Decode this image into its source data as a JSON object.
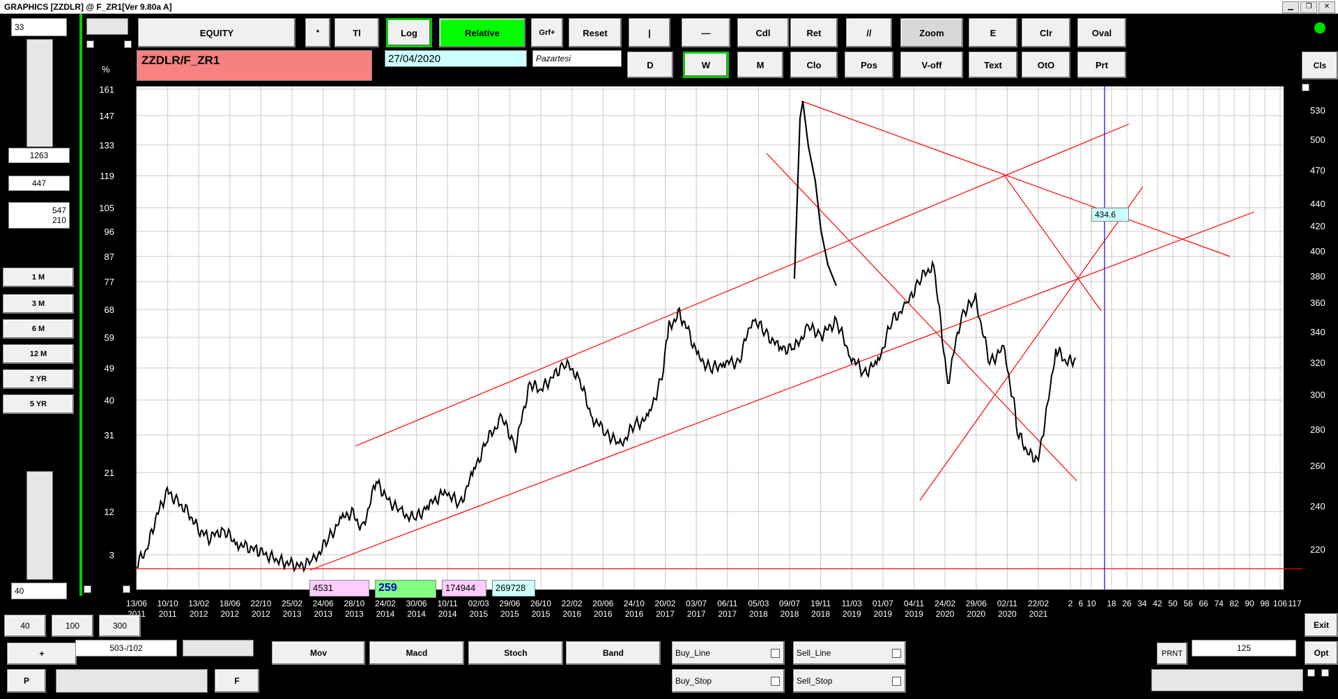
{
  "window": {
    "title": "GRAPHICS  [ZZDLR] @ F_ZR1[Ver 9.80a A]"
  },
  "left_panel": {
    "top_value": "33",
    "v1": "1263",
    "v2": "447",
    "v3a": "547",
    "v3b": "210",
    "period_buttons": [
      "1 M",
      "3 M",
      "6 M",
      "12 M",
      "2 YR",
      "5 YR"
    ],
    "bottom_value": "40"
  },
  "toolbar": {
    "row1": [
      "EQUITY",
      "*",
      "Tl",
      "Log",
      "Relative",
      "Grf+",
      "Reset",
      "|",
      "—",
      "Cdl",
      "Ret",
      "//",
      "Zoom",
      "E",
      "Clr",
      "Oval"
    ],
    "row2": [
      "D",
      "W",
      "M",
      "Clo",
      "Pos",
      "V-off",
      "Text",
      "OtO",
      "Prt"
    ],
    "cls": "Cls"
  },
  "info": {
    "symbol": "ZZDLR/F_ZR1",
    "date": "27/04/2020",
    "day": "Pazartesi",
    "percent_label": "%"
  },
  "y_left_ticks": [
    "161",
    "147",
    "133",
    "119",
    "105",
    "96",
    "87",
    "77",
    "68",
    "59",
    "49",
    "40",
    "31",
    "21",
    "12",
    "3"
  ],
  "y_right_ticks": [
    "530",
    "500",
    "470",
    "440",
    "420",
    "400",
    "380",
    "360",
    "340",
    "320",
    "300",
    "280",
    "260",
    "240",
    "220"
  ],
  "x_ticks": [
    {
      "d": "13/06",
      "y": "2011"
    },
    {
      "d": "10/10",
      "y": "2011"
    },
    {
      "d": "13/02",
      "y": "2012"
    },
    {
      "d": "18/06",
      "y": "2012"
    },
    {
      "d": "22/10",
      "y": "2012"
    },
    {
      "d": "25/02",
      "y": "2013"
    },
    {
      "d": "24/06",
      "y": "2013"
    },
    {
      "d": "28/10",
      "y": "2013"
    },
    {
      "d": "24/02",
      "y": "2014"
    },
    {
      "d": "30/06",
      "y": "2014"
    },
    {
      "d": "10/11",
      "y": "2014"
    },
    {
      "d": "02/03",
      "y": "2015"
    },
    {
      "d": "29/06",
      "y": "2015"
    },
    {
      "d": "26/10",
      "y": "2015"
    },
    {
      "d": "22/02",
      "y": "2016"
    },
    {
      "d": "20/06",
      "y": "2016"
    },
    {
      "d": "24/10",
      "y": "2016"
    },
    {
      "d": "20/02",
      "y": "2017"
    },
    {
      "d": "03/07",
      "y": "2017"
    },
    {
      "d": "06/11",
      "y": "2017"
    },
    {
      "d": "05/03",
      "y": "2018"
    },
    {
      "d": "09/07",
      "y": "2018"
    },
    {
      "d": "19/11",
      "y": "2018"
    },
    {
      "d": "11/03",
      "y": "2019"
    },
    {
      "d": "01/07",
      "y": "2019"
    },
    {
      "d": "04/11",
      "y": "2019"
    },
    {
      "d": "24/02",
      "y": "2020"
    },
    {
      "d": "29/06",
      "y": "2020"
    },
    {
      "d": "02/11",
      "y": "2020"
    },
    {
      "d": "22/02",
      "y": "2021"
    }
  ],
  "x_future_ticks": [
    "2",
    "6",
    "10",
    "18",
    "26",
    "34",
    "42",
    "50",
    "56",
    "66",
    "74",
    "82",
    "90",
    "98",
    "106",
    "117"
  ],
  "price_label": "434.6",
  "stat_boxes": [
    "4531",
    "259",
    "174944",
    "269728"
  ],
  "bottom": {
    "row1": [
      "40",
      "100",
      "300"
    ],
    "plus": "+",
    "counter": "503-/102",
    "p": "P",
    "f": "F",
    "indicators": [
      "Mov",
      "Macd",
      "Stoch",
      "Band"
    ],
    "orders": [
      "Buy_Line",
      "Sell_Line",
      "Buy_Stop",
      "Sell_Stop"
    ],
    "prnt": "PRNT",
    "prnt_value": "125",
    "exit": "Exit",
    "opt": "Opt"
  },
  "colors": {
    "grid": "#c8c8c8",
    "trendline": "#ff0000",
    "price": "#000000",
    "cursor": "#0000ff",
    "accent": "#00ff00"
  }
}
